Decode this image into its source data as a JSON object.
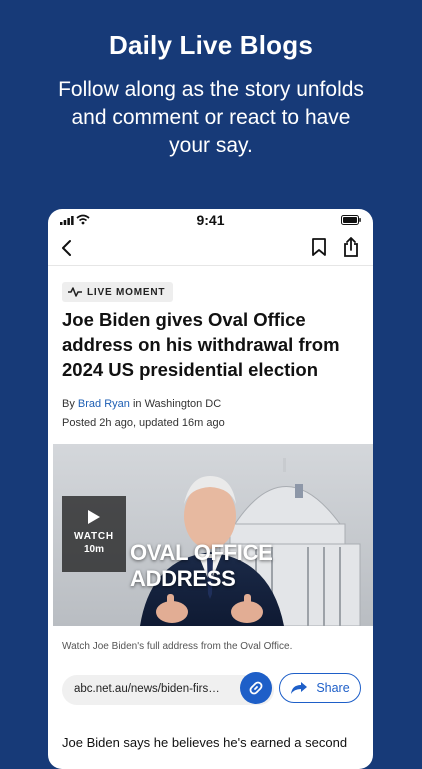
{
  "promo": {
    "title": "Daily Live Blogs",
    "subtitle": "Follow along as the story unfolds and comment or react to have your say."
  },
  "status_bar": {
    "time": "9:41"
  },
  "nav": {
    "icons": [
      "chevron-left-icon",
      "bookmark-icon",
      "share-icon"
    ]
  },
  "article": {
    "badge": "LIVE MOMENT",
    "headline": "Joe Biden gives Oval Office address on his withdrawal from 2024 US presidential election",
    "byline_prefix": "By",
    "author": "Brad Ryan",
    "location": "in Washington DC",
    "posted": "Posted 2h ago, updated 16m ago",
    "video": {
      "watch_label": "WATCH",
      "duration": "10m",
      "overlay_text": "OVAL OFFICE ADDRESS"
    },
    "caption": "Watch Joe Biden's full address from the Oval Office.",
    "share_url": "abc.net.au/news/biden-firs…",
    "share_label": "Share",
    "body_start": "Joe Biden says he believes he's earned a second"
  },
  "colors": {
    "background": "#173a78",
    "accent": "#1e5fc8"
  }
}
